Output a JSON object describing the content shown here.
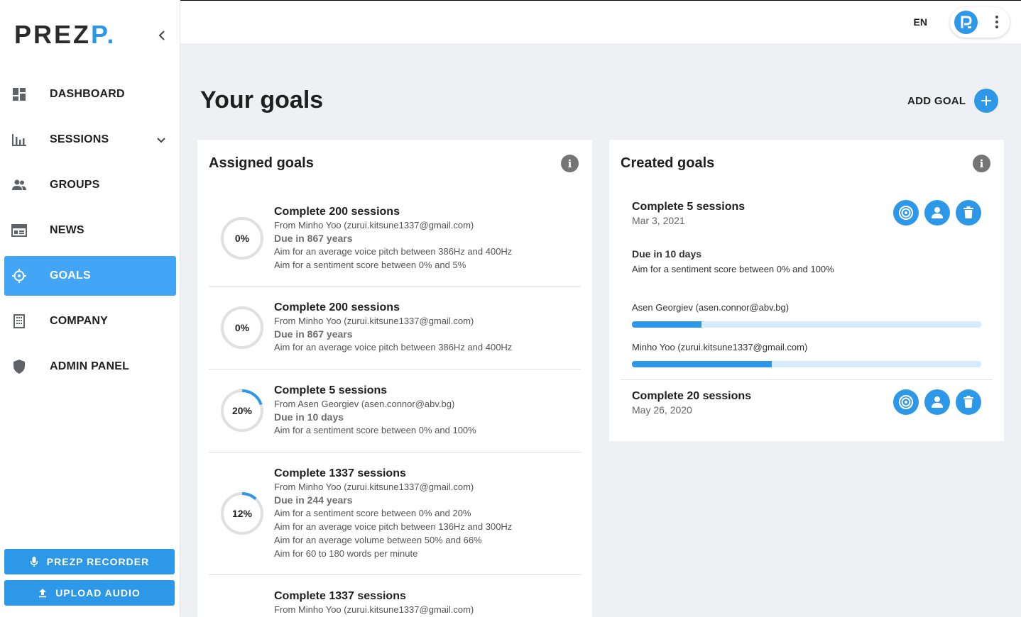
{
  "brand": {
    "logo_main": "PREZ",
    "logo_accent": "P.",
    "accent_color": "#2d97e8"
  },
  "sidebar": {
    "items": [
      {
        "label": "DASHBOARD",
        "icon": "dashboard-icon"
      },
      {
        "label": "SESSIONS",
        "icon": "bar-chart-icon"
      },
      {
        "label": "GROUPS",
        "icon": "people-icon"
      },
      {
        "label": "NEWS",
        "icon": "news-icon"
      },
      {
        "label": "GOALS",
        "icon": "crosshair-icon",
        "active": true
      },
      {
        "label": "COMPANY",
        "icon": "building-icon"
      },
      {
        "label": "ADMIN PANEL",
        "icon": "shield-icon"
      }
    ],
    "recorder_label": "PREZP RECORDER",
    "upload_label": "UPLOAD AUDIO"
  },
  "topbar": {
    "language": "EN"
  },
  "main": {
    "title": "Your goals",
    "add_goal_label": "ADD GOAL"
  },
  "assigned": {
    "title": "Assigned goals",
    "goals": [
      {
        "progress_label": "0%",
        "progress": 0,
        "name": "Complete 200 sessions",
        "from": "From Minho Yoo (zurui.kitsune1337@gmail.com)",
        "due": "Due in 867 years",
        "lines": [
          "Aim for an average voice pitch between 386Hz and 400Hz",
          "Aim for a sentiment score between 0% and 5%"
        ]
      },
      {
        "progress_label": "0%",
        "progress": 0,
        "name": "Complete 200 sessions",
        "from": "From Minho Yoo (zurui.kitsune1337@gmail.com)",
        "due": "Due in 867 years",
        "lines": [
          "Aim for an average voice pitch between 386Hz and 400Hz"
        ]
      },
      {
        "progress_label": "20%",
        "progress": 0.2,
        "name": "Complete 5 sessions",
        "from": "From Asen Georgiev (asen.connor@abv.bg)",
        "due": "Due in 10 days",
        "lines": [
          "Aim for a sentiment score between 0% and 100%"
        ]
      },
      {
        "progress_label": "12%",
        "progress": 0.12,
        "name": "Complete 1337 sessions",
        "from": "From Minho Yoo (zurui.kitsune1337@gmail.com)",
        "due": "Due in 244 years",
        "lines": [
          "Aim for a sentiment score between 0% and 20%",
          "Aim for an average voice pitch between 136Hz and 300Hz",
          "Aim for an average volume between 50% and 66%",
          "Aim for 60 to 180 words per minute"
        ]
      },
      {
        "progress_label": "",
        "progress": 0,
        "name": "Complete 1337 sessions",
        "from": "From Minho Yoo (zurui.kitsune1337@gmail.com)",
        "due": "",
        "lines": []
      }
    ]
  },
  "created": {
    "title": "Created goals",
    "goals": [
      {
        "name": "Complete 5 sessions",
        "date": "Mar 3, 2021",
        "due": "Due in 10 days",
        "criteria": "Aim for a sentiment score between 0% and 100%",
        "assignees": [
          {
            "name": "Asen Georgiev (asen.connor@abv.bg)",
            "progress": 0.2
          },
          {
            "name": "Minho Yoo (zurui.kitsune1337@gmail.com)",
            "progress": 0.4
          }
        ]
      },
      {
        "name": "Complete 20 sessions",
        "date": "May 26, 2020"
      }
    ],
    "action_icons": [
      "target-icon",
      "person-icon",
      "trash-icon"
    ]
  }
}
